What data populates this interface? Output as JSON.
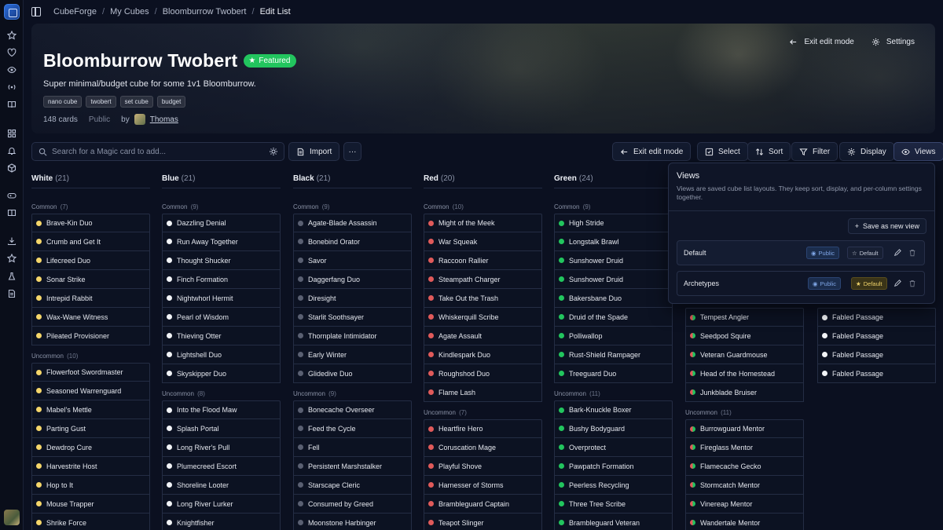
{
  "breadcrumb": [
    "CubeForge",
    "My Cubes",
    "Bloomburrow Twobert",
    "Edit List"
  ],
  "cube": {
    "title": "Bloomburrow Twobert",
    "featured_label": "Featured",
    "description": "Super minimal/budget cube for some 1v1 Bloomburrow.",
    "tags": [
      "nano cube",
      "twobert",
      "set cube",
      "budget"
    ],
    "card_count": "148 cards",
    "visibility": "Public",
    "by_label": "by",
    "owner": "Thomas"
  },
  "banner_actions": {
    "exit": "Exit edit mode",
    "settings": "Settings"
  },
  "toolbar": {
    "search_placeholder": "Search for a Magic card to add...",
    "import": "Import",
    "more": "···",
    "exit": "Exit edit mode",
    "select": "Select",
    "sort": "Sort",
    "filter": "Filter",
    "display": "Display",
    "views": "Views"
  },
  "colors": {
    "white": "#f5d66a",
    "blue": "#f2f4f7",
    "black": "#5a6072",
    "red": "#e05a5a",
    "green": "#22c55e",
    "accent": "#22c55e"
  },
  "columns": [
    {
      "name": "White",
      "count": "(21)",
      "dot": "w",
      "groups": [
        {
          "label": "Common",
          "count": "(7)",
          "cards": [
            "Brave-Kin Duo",
            "Crumb and Get It",
            "Lifecreed Duo",
            "Sonar Strike",
            "Intrepid Rabbit",
            "Wax-Wane Witness",
            "Pileated Provisioner"
          ]
        },
        {
          "label": "Uncommon",
          "count": "(10)",
          "cards": [
            "Flowerfoot Swordmaster",
            "Seasoned Warrenguard",
            "Mabel's Mettle",
            "Parting Gust",
            "Dewdrop Cure",
            "Harvestrite Host",
            "Hop to It",
            "Mouse Trapper",
            "Shrike Force"
          ]
        }
      ]
    },
    {
      "name": "Blue",
      "count": "(21)",
      "dot": "u",
      "groups": [
        {
          "label": "Common",
          "count": "(9)",
          "cards": [
            "Dazzling Denial",
            "Run Away Together",
            "Thought Shucker",
            "Finch Formation",
            "Nightwhorl Hermit",
            "Pearl of Wisdom",
            "Thieving Otter",
            "Lightshell Duo",
            "Skyskipper Duo"
          ]
        },
        {
          "label": "Uncommon",
          "count": "(8)",
          "cards": [
            "Into the Flood Maw",
            "Splash Portal",
            "Long River's Pull",
            "Plumecreed Escort",
            "Shoreline Looter",
            "Long River Lurker",
            "Knightfisher"
          ]
        }
      ]
    },
    {
      "name": "Black",
      "count": "(21)",
      "dot": "b",
      "groups": [
        {
          "label": "Common",
          "count": "(9)",
          "cards": [
            "Agate-Blade Assassin",
            "Bonebind Orator",
            "Savor",
            "Daggerfang Duo",
            "Diresight",
            "Starlit Soothsayer",
            "Thornplate Intimidator",
            "Early Winter",
            "Glidedive Duo"
          ]
        },
        {
          "label": "Uncommon",
          "count": "(9)",
          "cards": [
            "Bonecache Overseer",
            "Feed the Cycle",
            "Fell",
            "Persistent Marshstalker",
            "Starscape Cleric",
            "Consumed by Greed",
            "Moonstone Harbinger"
          ]
        }
      ]
    },
    {
      "name": "Red",
      "count": "(20)",
      "dot": "r",
      "groups": [
        {
          "label": "Common",
          "count": "(10)",
          "cards": [
            "Might of the Meek",
            "War Squeak",
            "Raccoon Rallier",
            "Steampath Charger",
            "Take Out the Trash",
            "Whiskerquill Scribe",
            "Agate Assault",
            "Kindlespark Duo",
            "Roughshod Duo",
            "Flame Lash"
          ]
        },
        {
          "label": "Uncommon",
          "count": "(7)",
          "cards": [
            "Heartfire Hero",
            "Coruscation Mage",
            "Playful Shove",
            "Harnesser of Storms",
            "Brambleguard Captain",
            "Teapot Slinger"
          ]
        }
      ]
    },
    {
      "name": "Green",
      "count": "(24)",
      "dot": "g",
      "groups": [
        {
          "label": "Common",
          "count": "(9)",
          "cards": [
            "High Stride",
            "Longstalk Brawl",
            "Sunshower Druid",
            "Sunshower Druid",
            "Bakersbane Duo",
            "Druid of the Spade",
            "Polliwallop",
            "Rust-Shield Rampager",
            "Treeguard Duo"
          ]
        },
        {
          "label": "Uncommon",
          "count": "(11)",
          "cards": [
            "Bark-Knuckle Boxer",
            "Bushy Bodyguard",
            "Overprotect",
            "Pawpatch Formation",
            "Peerless Recycling",
            "Three Tree Scribe",
            "Brambleguard Veteran"
          ]
        }
      ]
    }
  ],
  "multicolor_partial": {
    "common_cards": [
      "Tempest Angler",
      "Seedpod Squire",
      "Veteran Guardmouse",
      "Head of the Homestead",
      "Junkblade Bruiser"
    ],
    "uncommon_label": "Uncommon",
    "uncommon_count": "(11)",
    "uncommon_cards": [
      "Burrowguard Mentor",
      "Fireglass Mentor",
      "Flamecache Gecko",
      "Stormcatch Mentor",
      "Vinereap Mentor",
      "Wandertale Mentor"
    ]
  },
  "land_partial": {
    "cards": [
      "Fabled Passage",
      "Fabled Passage",
      "Fabled Passage",
      "Fabled Passage"
    ]
  },
  "views_popover": {
    "title": "Views",
    "description": "Views are saved cube list layouts. They keep sort, display, and per-column settings together.",
    "save_label": "Save as new view",
    "rows": [
      {
        "name": "Default",
        "public": "Public",
        "default": "Default",
        "is_default": false
      },
      {
        "name": "Archetypes",
        "public": "Public",
        "default": "Default",
        "is_default": true
      }
    ]
  }
}
